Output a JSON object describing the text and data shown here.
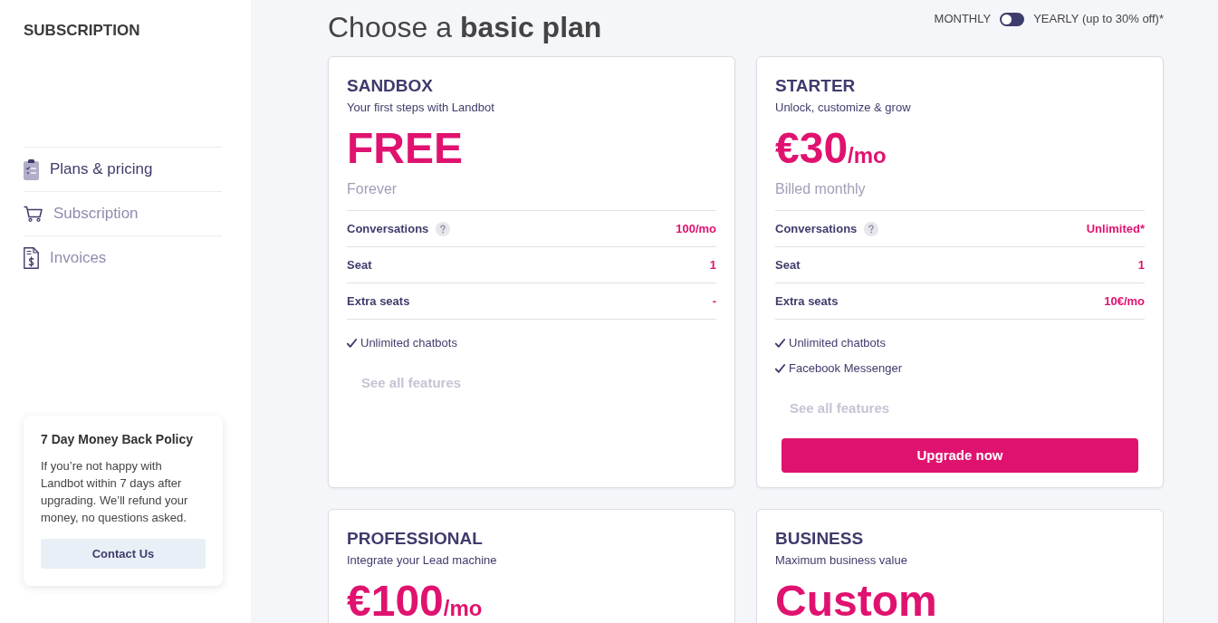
{
  "sidebar": {
    "title": "SUBSCRIPTION",
    "items": [
      {
        "label": "Plans & pricing",
        "selected": true
      },
      {
        "label": "Subscription",
        "selected": false
      },
      {
        "label": "Invoices",
        "selected": false
      }
    ],
    "policy_card": {
      "title": "7 Day Money Back Policy",
      "text": "If you’re not happy with Landbot within 7 days after upgrading. We’ll refund your money, no questions asked.",
      "button": "Contact Us"
    }
  },
  "main": {
    "heading": "Choose a **basic plan**",
    "billing_toggle": {
      "left_label": "MONTHLY",
      "right_label": "YEARLY (up to 30% off)*",
      "on": false
    },
    "plans": [
      {
        "name": "SANDBOX",
        "tagline": "Your first steps with Landbot",
        "price": "FREE",
        "price_note": "Forever",
        "rows": [
          {
            "label": "Conversations",
            "help": true,
            "value": "100/mo"
          },
          {
            "label": "Seat",
            "help": false,
            "value": "1"
          },
          {
            "label": "Extra seats",
            "help": false,
            "value": "-"
          }
        ],
        "features": [
          "Unlimited chatbots"
        ],
        "link": "See all features"
      },
      {
        "name": "STARTER",
        "tagline": "Unlock, customize & grow",
        "price": "€30",
        "price_unit": "/mo",
        "price_note": "Billed monthly",
        "rows": [
          {
            "label": "Conversations",
            "help": true,
            "value": "Unlimited*"
          },
          {
            "label": "Seat",
            "help": false,
            "value": "1"
          },
          {
            "label": "Extra seats",
            "help": false,
            "value": "10€/mo"
          }
        ],
        "features": [
          "Unlimited chatbots",
          "Facebook Messenger"
        ],
        "link": "See all features",
        "button": "Upgrade now"
      },
      {
        "name": "PROFESSIONAL",
        "tagline": "Integrate your Lead machine",
        "price": "€100",
        "price_unit": "/mo"
      },
      {
        "name": "BUSINESS",
        "tagline": "Maximum business value",
        "price": "Custom"
      }
    ]
  }
}
